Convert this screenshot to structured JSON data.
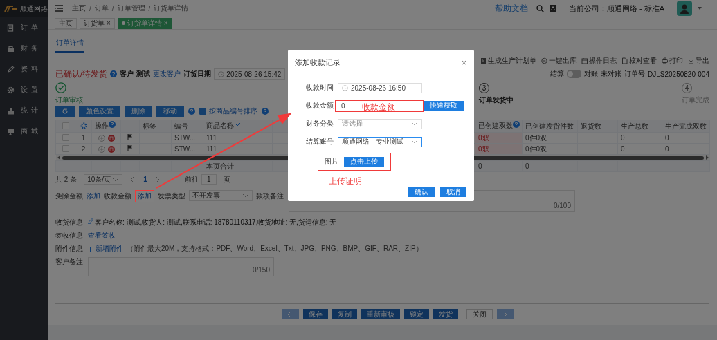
{
  "sidebar": {
    "logo": "顺通网络",
    "items": [
      {
        "label": "订单"
      },
      {
        "label": "财务"
      },
      {
        "label": "资料"
      },
      {
        "label": "设置"
      },
      {
        "label": "统计"
      },
      {
        "label": "商城"
      }
    ]
  },
  "header": {
    "breadcrumb": [
      "主页",
      "订单",
      "订单管理",
      "订货单详情"
    ],
    "separator": "/",
    "help_link": "帮助文档",
    "company": "当前公司：顺通网络 - 标准A"
  },
  "tabs": [
    {
      "label": "主页",
      "selected": false
    },
    {
      "label": "订货单",
      "close": "×",
      "selected": false
    },
    {
      "label": "订货单详情",
      "close": "×",
      "selected": true
    }
  ],
  "subtabs": [
    {
      "label": "订单详情",
      "selected": true
    }
  ],
  "toolbar": [
    "生成生产计划单",
    "一键出库",
    "操作日志",
    "核对查看",
    "打印",
    "导出"
  ],
  "order": {
    "status": "已确认/待发货",
    "customer_label": "客户",
    "customer": "测试",
    "change_customer": "更改客户",
    "date_label": "订货日期",
    "date": "2025-08-26 15:42",
    "settle_label": "结算",
    "reconcile_on": false,
    "reconcile_label": "对账",
    "reconcile_status": "未对账",
    "order_no_label": "订单号",
    "order_no": "DJLS20250820-004"
  },
  "steps": [
    {
      "kind": "done",
      "label": "订单审核"
    },
    {
      "kind": "active",
      "number": "3",
      "label": "订单发货中"
    },
    {
      "kind": "pending",
      "number": "4",
      "label": "订单完成"
    }
  ],
  "actions": {
    "buttons": [
      {
        "label": "颜色设置"
      },
      {
        "label": "删除"
      },
      {
        "label": "移动",
        "help": true
      }
    ],
    "sort_checkbox": {
      "label": "按商品编号排序",
      "checked": true,
      "help": true
    }
  },
  "table": {
    "columns": [
      {
        "kind": "checkbox",
        "checked": false
      },
      {
        "kind": "settings"
      },
      {
        "kind": "text",
        "label": "操作",
        "help": true
      },
      {
        "kind": "blank"
      },
      {
        "kind": "text",
        "label": "标签"
      },
      {
        "kind": "text",
        "label": "编号"
      },
      {
        "kind": "sort",
        "label": "商品名称"
      },
      {
        "kind": "blank"
      },
      {
        "kind": "text",
        "label": "已创建双数",
        "help": true
      },
      {
        "kind": "text",
        "label": "已创建发货件数"
      },
      {
        "kind": "text",
        "label": "退货数"
      },
      {
        "kind": "text",
        "label": "生产总数"
      },
      {
        "kind": "text",
        "label": "生产完成双数"
      }
    ],
    "rows": [
      {
        "cells": [
          {
            "kind": "checkbox",
            "checked": false
          },
          {
            "kind": "center",
            "text": "1"
          },
          {
            "kind": "actions"
          },
          {
            "kind": "flag"
          },
          {
            "kind": "empty"
          },
          {
            "kind": "text",
            "text": "STW..."
          },
          {
            "kind": "text",
            "text": "111"
          },
          {
            "kind": "empty"
          },
          {
            "kind": "alert",
            "text": "0双"
          },
          {
            "kind": "text",
            "text": "0件0双"
          },
          {
            "kind": "empty"
          },
          {
            "kind": "text",
            "text": "0"
          },
          {
            "kind": "text",
            "text": "0"
          }
        ]
      },
      {
        "cells": [
          {
            "kind": "checkbox",
            "checked": false
          },
          {
            "kind": "center",
            "text": "2"
          },
          {
            "kind": "actions"
          },
          {
            "kind": "flag"
          },
          {
            "kind": "empty"
          },
          {
            "kind": "text",
            "text": "STW..."
          },
          {
            "kind": "text",
            "text": "111"
          },
          {
            "kind": "empty"
          },
          {
            "kind": "alert",
            "text": "0双"
          },
          {
            "kind": "text",
            "text": "0件0双"
          },
          {
            "kind": "empty"
          },
          {
            "kind": "text",
            "text": "0"
          },
          {
            "kind": "text",
            "text": "0"
          }
        ]
      }
    ],
    "footer": [
      {
        "kind": "empty"
      },
      {
        "kind": "empty"
      },
      {
        "kind": "empty"
      },
      {
        "kind": "empty"
      },
      {
        "kind": "empty"
      },
      {
        "kind": "empty"
      },
      {
        "kind": "text",
        "text": "本页合计"
      },
      {
        "kind": "empty"
      },
      {
        "kind": "text",
        "text": "0"
      },
      {
        "kind": "text",
        "text": "0"
      },
      {
        "kind": "empty"
      },
      {
        "kind": "empty"
      },
      {
        "kind": "empty"
      }
    ]
  },
  "pagination": {
    "total": "共 2 条",
    "page_size": "10条/页",
    "pages": [
      {
        "label": "1",
        "selected": true
      }
    ],
    "goto_label": "前往",
    "goto_value": "1",
    "page_unit": "页"
  },
  "payment": {
    "waive_label": "免除金额",
    "waive_link": "添加",
    "receive_label": "收款金额",
    "receive_link": {
      "text": "添加",
      "highlighted": true,
      "arrow": true
    },
    "invoice_label": "发票类型",
    "invoice_value": "不开发票",
    "remark_label": "款项备注",
    "remark_counter": "0/100"
  },
  "info": [
    {
      "kind": "text",
      "label": "收货信息",
      "text": "客户名称: 测试,收货人: 测试,联系电话: 18780110317,收货地址: 无,货运信息: 无"
    },
    {
      "kind": "link",
      "label": "签收信息",
      "text": "查看签收"
    },
    {
      "kind": "attach",
      "label": "附件信息",
      "text": "新增附件",
      "note": "（附件最大20M，支持格式：PDF、Word、Excel、Txt、JPG、PNG、BMP、GIF、RAR、ZIP）"
    },
    {
      "kind": "textarea",
      "label": "客户备注",
      "counter": "0/150"
    }
  ],
  "bottom_bar": [
    {
      "kind": "prev",
      "disabled": true
    },
    {
      "kind": "primary",
      "label": "保存"
    },
    {
      "kind": "primary",
      "label": "复制"
    },
    {
      "kind": "primary",
      "label": "重新审核"
    },
    {
      "kind": "primary",
      "label": "锁定"
    },
    {
      "kind": "primary",
      "label": "发货"
    },
    {
      "kind": "plain",
      "label": "关闭"
    },
    {
      "kind": "next",
      "disabled": true
    }
  ],
  "dialog": {
    "title": "添加收款记录",
    "close": "×",
    "fields": [
      {
        "kind": "date",
        "label": "收款时间",
        "value": "2025-08-26 16:50"
      },
      {
        "kind": "amount",
        "label": "收款金额",
        "value": "0",
        "button": "快速获取",
        "highlighted": true,
        "note": "收款金额"
      },
      {
        "kind": "select",
        "label": "财务分类",
        "placeholder": "请选择",
        "focused": false
      },
      {
        "kind": "select",
        "label": "结算账号",
        "value": "顺通网络 - 专业测试-",
        "focused": true
      },
      {
        "kind": "upload",
        "label": "图片",
        "button": "点击上传",
        "highlighted": true,
        "note": "上传证明"
      }
    ],
    "buttons": [
      "确认",
      "取消"
    ]
  }
}
